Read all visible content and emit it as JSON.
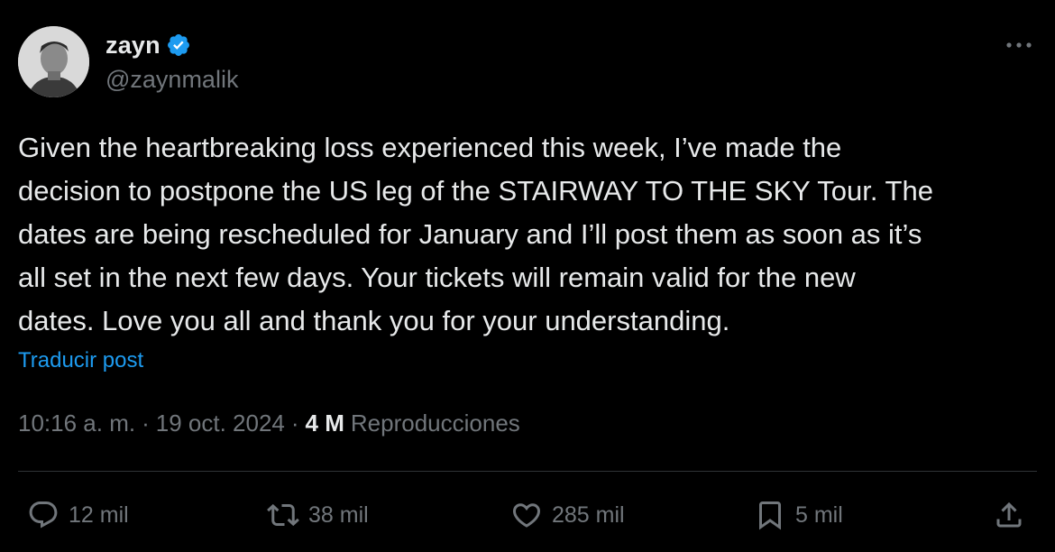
{
  "author": {
    "display_name": "zayn",
    "handle": "@zaynmalik",
    "verified": true,
    "verified_color": "#1d9bf0"
  },
  "tweet": {
    "text": "Given the heartbreaking loss experienced this week, I’ve made the\ndecision to postpone the US leg of the STAIRWAY TO THE SKY Tour. The\ndates are being rescheduled for January and I’ll post them as soon as it’s\nall set in the next few days. Your tickets will remain valid for the new\ndates. Love you all and thank you for your understanding.",
    "translate_label": "Traducir post"
  },
  "meta": {
    "time": "10:16 a. m.",
    "separator": "·",
    "date": "19 oct. 2024",
    "views_count": "4 M",
    "views_label": "Reproducciones"
  },
  "actions": {
    "replies": "12 mil",
    "retweets": "38 mil",
    "likes": "285 mil",
    "bookmarks": "5 mil"
  },
  "icons": {
    "more": "more-horizontal-icon",
    "reply": "reply-icon",
    "retweet": "retweet-icon",
    "like": "heart-icon",
    "bookmark": "bookmark-icon",
    "share": "share-icon"
  },
  "colors": {
    "background": "#000000",
    "text_primary": "#e7e9ea",
    "text_secondary": "#71767b",
    "link": "#1d9bf0",
    "divider": "#2f3336"
  }
}
